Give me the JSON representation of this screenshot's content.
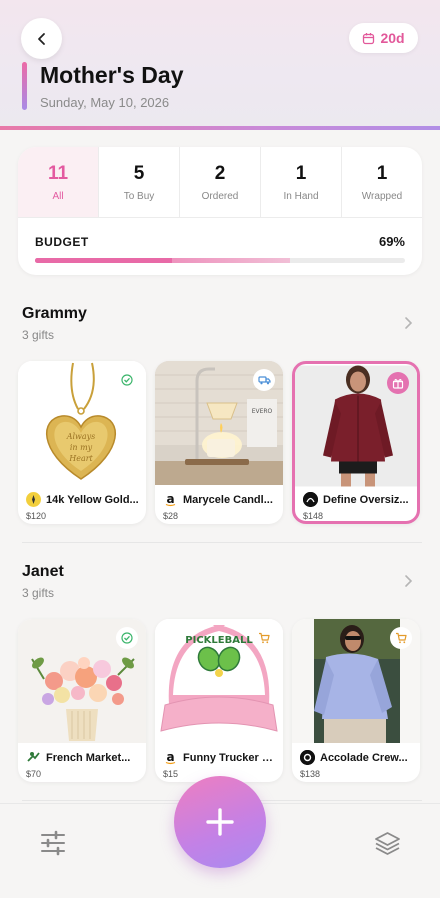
{
  "header": {
    "back_icon": "chevron-left-icon",
    "days_left": "20d",
    "days_icon": "calendar-icon",
    "title": "Mother's Day",
    "date": "Sunday, May 10, 2026"
  },
  "colors": {
    "accent": "#e2589a",
    "accent_soft": "#fbeff3",
    "gradient_start": "#ee7ec0",
    "gradient_end": "#a98bf0"
  },
  "stats": [
    {
      "count": "11",
      "label": "All",
      "active": true
    },
    {
      "count": "5",
      "label": "To Buy",
      "active": false
    },
    {
      "count": "2",
      "label": "Ordered",
      "active": false
    },
    {
      "count": "1",
      "label": "In Hand",
      "active": false
    },
    {
      "count": "1",
      "label": "Wrapped",
      "active": false
    }
  ],
  "budget": {
    "label": "BUDGET",
    "percent_text": "69%",
    "spent_fraction": 0.37,
    "committed_fraction": 0.69
  },
  "sections": [
    {
      "name": "Grammy",
      "count": "3 gifts",
      "gifts": [
        {
          "name": "14k Yellow Gold...",
          "price": "$120",
          "store_icon": "gold-store-logo",
          "status_icon": "check-icon",
          "selected": false
        },
        {
          "name": "Marycele Candl...",
          "price": "$28",
          "store_icon": "amazon-logo",
          "status_icon": "truck-icon",
          "selected": false
        },
        {
          "name": "Define Oversiz...",
          "price": "$148",
          "store_icon": "lululemon-logo",
          "status_icon": "gift-icon",
          "selected": true
        }
      ]
    },
    {
      "name": "Janet",
      "count": "3 gifts",
      "gifts": [
        {
          "name": "French Market...",
          "price": "$70",
          "store_icon": "florist-logo",
          "status_icon": "check-icon",
          "selected": false
        },
        {
          "name": "Funny Trucker H...",
          "price": "$15",
          "store_icon": "amazon-logo",
          "status_icon": "cart-icon",
          "selected": false
        },
        {
          "name": "Accolade Crew...",
          "price": "$138",
          "store_icon": "alo-logo",
          "status_icon": "cart-icon",
          "selected": false
        }
      ]
    }
  ],
  "hat_text": "PICKLEBALL",
  "bottom_bar": {
    "left_icon": "sliders-icon",
    "center_icon": "plus-icon",
    "right_icon": "layers-icon"
  }
}
